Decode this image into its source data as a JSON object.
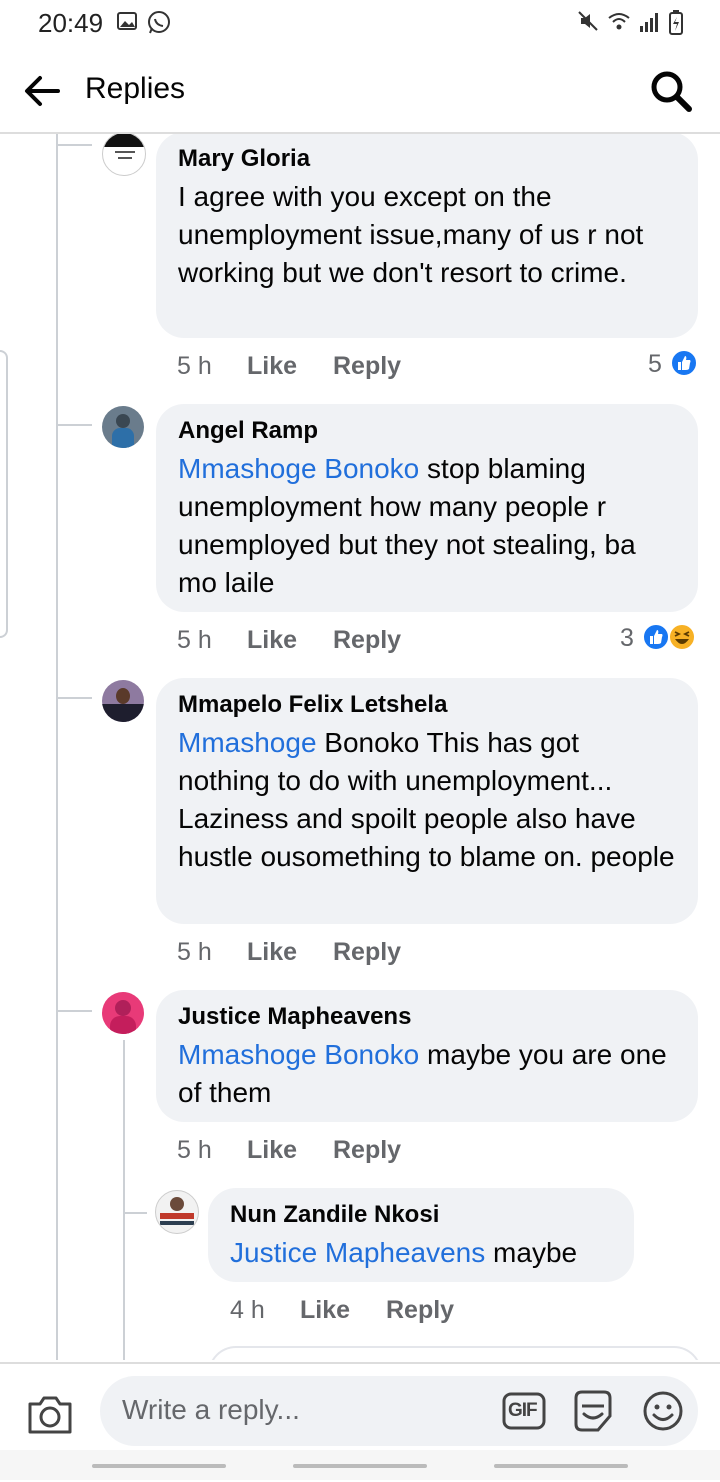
{
  "status": {
    "time": "20:49"
  },
  "header": {
    "title": "Replies"
  },
  "comments": [
    {
      "author": "Mary Gloria",
      "mention": "",
      "text": "I agree with you except on the unemployment issue,many of us r not working but we don't resort to crime.",
      "time": "5 h",
      "like": "Like",
      "reply": "Reply",
      "reaction_count": "5",
      "reactions": [
        "like-icon"
      ]
    },
    {
      "author": "Angel Ramp",
      "mention": "Mmashoge Bonoko",
      "text": " stop blaming unemployment how many people r unemployed but they not stealing, ba mo laile",
      "time": "5 h",
      "like": "Like",
      "reply": "Reply",
      "reaction_count": "3",
      "reactions": [
        "like-icon",
        "haha-icon"
      ]
    },
    {
      "author": "Mmapelo Felix Letshela",
      "mention": "Mmashoge",
      "text": " Bonoko This has got nothing to do with unemployment... Laziness and spoilt people also have hustle ousomething to blame on. people",
      "time": "5 h",
      "like": "Like",
      "reply": "Reply"
    },
    {
      "author": "Justice Mapheavens",
      "mention": "Mmashoge Bonoko",
      "text": " maybe you are one of them",
      "time": "5 h",
      "like": "Like",
      "reply": "Reply"
    },
    {
      "author": "Nun Zandile Nkosi",
      "mention": "Justice Mapheavens",
      "text": " maybe",
      "time": "4 h",
      "like": "Like",
      "reply": "Reply"
    }
  ],
  "composer": {
    "placeholder": "Write a reply...",
    "gif_label": "GIF",
    "icons": [
      "camera-icon",
      "gif-icon",
      "sticker-icon",
      "emoji-icon"
    ]
  },
  "colors": {
    "mention": "#216fdb",
    "bubble": "#f0f2f5",
    "like_blue": "#1877f2"
  }
}
